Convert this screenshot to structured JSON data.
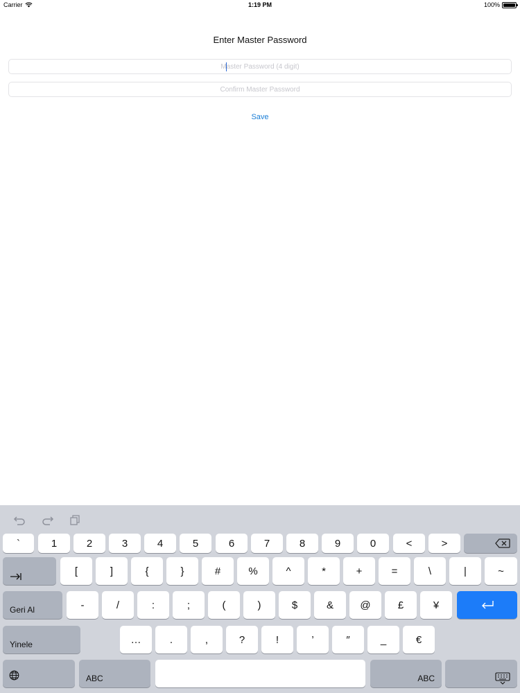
{
  "status_bar": {
    "carrier": "Carrier",
    "time": "1:19 PM",
    "battery": "100%",
    "battery_level": 1.0
  },
  "form": {
    "title": "Enter Master Password",
    "password_placeholder": "Master Password (4 digit)",
    "confirm_placeholder": "Confirm Master Password",
    "save_label": "Save"
  },
  "keyboard": {
    "shortcuts": [
      "undo-icon",
      "redo-icon",
      "paste-icon"
    ],
    "row1": [
      "`",
      "1",
      "2",
      "3",
      "4",
      "5",
      "6",
      "7",
      "8",
      "9",
      "0",
      "<",
      ">"
    ],
    "delete_key": "delete-icon",
    "tab_key": "tab-icon",
    "row2": [
      "[",
      "]",
      "{",
      "}",
      "#",
      "%",
      "^",
      "*",
      "+",
      "=",
      "\\",
      "|",
      "~"
    ],
    "undo_label": "Geri Al",
    "row3": [
      "-",
      "/",
      ":",
      ";",
      "(",
      ")",
      "$",
      "&",
      "@",
      "£",
      "¥"
    ],
    "return_key": "return-icon",
    "redo_label": "Yinele",
    "row4": [
      "…",
      ".",
      ",",
      "?",
      "!",
      "’",
      "″",
      "_",
      "€"
    ],
    "globe_key": "globe-icon",
    "abc_left": "ABC",
    "abc_right": "ABC",
    "dismiss_key": "keyboard-dismiss-icon"
  },
  "colors": {
    "link": "#1a7ed6",
    "return_key": "#1c7cf9",
    "keyboard_bg": "#d1d4db"
  }
}
